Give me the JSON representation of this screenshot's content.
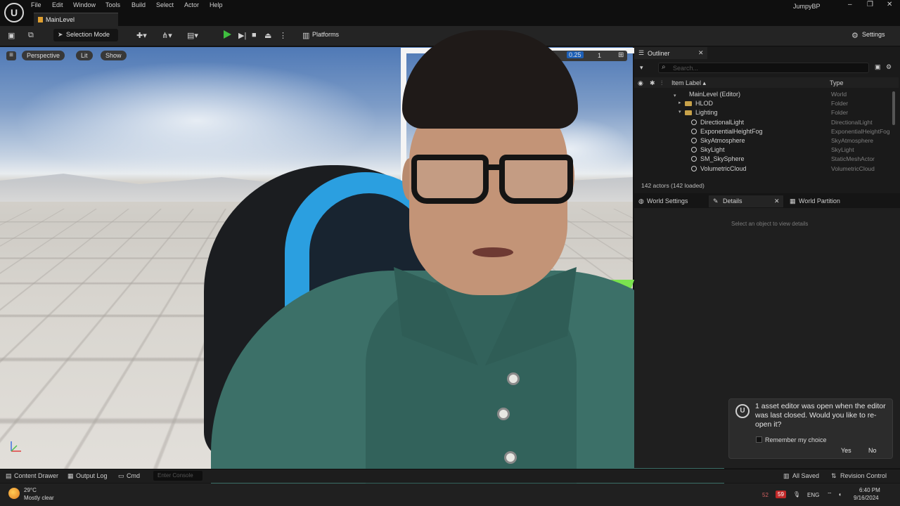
{
  "app": {
    "logo": "U",
    "menu": [
      "File",
      "Edit",
      "Window",
      "Tools",
      "Build",
      "Select",
      "Actor",
      "Help"
    ],
    "project": "JumpyBP",
    "window_controls": [
      "–",
      "❐",
      "✕"
    ]
  },
  "tab": {
    "label": "MainLevel"
  },
  "toolbar": {
    "selection_mode": "Selection Mode",
    "platforms": "Platforms",
    "settings": "Settings"
  },
  "viewport": {
    "menu": "≡",
    "perspective": "Perspective",
    "lit": "Lit",
    "show": "Show",
    "camera_speed": "0.25",
    "camera_index": "1"
  },
  "outliner": {
    "title": "Outliner",
    "close": "✕",
    "search_placeholder": "Search...",
    "col_label": "Item Label ▴",
    "col_type": "Type",
    "rows": [
      {
        "label": "MainLevel (Editor)",
        "type": "World"
      },
      {
        "label": "HLOD",
        "type": "Folder"
      },
      {
        "label": "Lighting",
        "type": "Folder"
      },
      {
        "label": "DirectionalLight",
        "type": "DirectionalLight"
      },
      {
        "label": "ExponentialHeightFog",
        "type": "ExponentialHeightFog"
      },
      {
        "label": "SkyAtmosphere",
        "type": "SkyAtmosphere"
      },
      {
        "label": "SkyLight",
        "type": "SkyLight"
      },
      {
        "label": "SM_SkySphere",
        "type": "StaticMeshActor"
      },
      {
        "label": "VolumetricCloud",
        "type": "VolumetricCloud"
      }
    ],
    "actor_count": "142 actors (142 loaded)"
  },
  "details": {
    "tabs": [
      "World Settings",
      "Details",
      "World Partition"
    ],
    "close": "✕",
    "hint": "Select an object to view details"
  },
  "notification": {
    "logo": "U",
    "message": "1 asset editor was open when the editor was last closed. Would you like to re-open it?",
    "remember": "Remember my choice",
    "yes": "Yes",
    "no": "No"
  },
  "bottombar": {
    "content_drawer": "Content Drawer",
    "output_log": "Output Log",
    "cmd": "Cmd",
    "console_placeholder": "Enter Console",
    "all_saved": "All Saved",
    "revision_control": "Revision Control"
  },
  "taskbar": {
    "temperature": "29°C",
    "weather": "Mostly clear",
    "badge_a": "52",
    "badge_b": "59",
    "language": "ENG",
    "time": "6:40 PM",
    "date": "9/16/2024"
  }
}
